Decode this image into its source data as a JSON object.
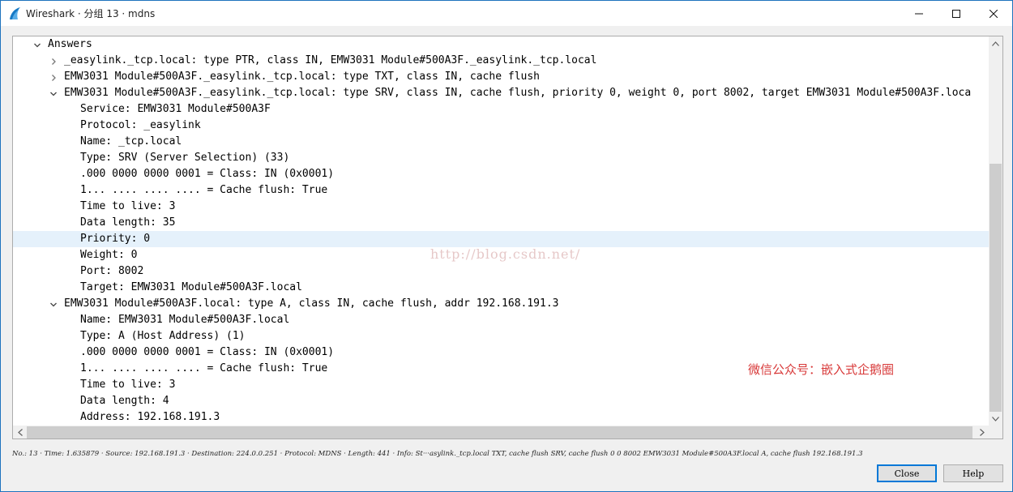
{
  "window": {
    "title": "Wireshark · 分组 13 · mdns"
  },
  "colors": {
    "accent": "#0078d7",
    "selection": "#e5f1fb",
    "overlay_red": "#d83a3a"
  },
  "tree": {
    "rows": [
      {
        "text": "Answers",
        "chevron": "down"
      },
      {
        "text": "_easylink._tcp.local: type PTR, class IN, EMW3031 Module#500A3F._easylink._tcp.local",
        "chevron": "right"
      },
      {
        "text": "EMW3031 Module#500A3F._easylink._tcp.local: type TXT, class IN, cache flush",
        "chevron": "right"
      },
      {
        "text": "EMW3031 Module#500A3F._easylink._tcp.local: type SRV, class IN, cache flush, priority 0, weight 0, port 8002, target EMW3031 Module#500A3F.loca",
        "chevron": "down"
      },
      {
        "text": "Service: EMW3031 Module#500A3F",
        "chevron": ""
      },
      {
        "text": "Protocol: _easylink",
        "chevron": ""
      },
      {
        "text": "Name: _tcp.local",
        "chevron": ""
      },
      {
        "text": "Type: SRV (Server Selection) (33)",
        "chevron": ""
      },
      {
        "text": ".000 0000 0000 0001 = Class: IN (0x0001)",
        "chevron": ""
      },
      {
        "text": "1... .... .... .... = Cache flush: True",
        "chevron": ""
      },
      {
        "text": "Time to live: 3",
        "chevron": ""
      },
      {
        "text": "Data length: 35",
        "chevron": ""
      },
      {
        "text": "Priority: 0",
        "chevron": ""
      },
      {
        "text": "Weight: 0",
        "chevron": ""
      },
      {
        "text": "Port: 8002",
        "chevron": ""
      },
      {
        "text": "Target: EMW3031 Module#500A3F.local",
        "chevron": ""
      },
      {
        "text": "EMW3031 Module#500A3F.local: type A, class IN, cache flush, addr 192.168.191.3",
        "chevron": "down"
      },
      {
        "text": "Name: EMW3031 Module#500A3F.local",
        "chevron": ""
      },
      {
        "text": "Type: A (Host Address) (1)",
        "chevron": ""
      },
      {
        "text": ".000 0000 0000 0001 = Class: IN (0x0001)",
        "chevron": ""
      },
      {
        "text": "1... .... .... .... = Cache flush: True",
        "chevron": ""
      },
      {
        "text": "Time to live: 3",
        "chevron": ""
      },
      {
        "text": "Data length: 4",
        "chevron": ""
      },
      {
        "text": "Address: 192.168.191.3",
        "chevron": ""
      }
    ]
  },
  "watermark": "http://blog.csdn.net/",
  "overlay_label": "微信公众号：嵌入式企鹅圈",
  "status_bar": "No.: 13 · Time: 1.635879 · Source: 192.168.191.3 · Destination: 224.0.0.251 · Protocol: MDNS · Length: 441 · Info: St···asylink._tcp.local TXT, cache flush SRV, cache flush 0 0 8002 EMW3031 Module#500A3F.local A, cache flush 192.168.191.3",
  "buttons": {
    "close": "Close",
    "help": "Help"
  }
}
